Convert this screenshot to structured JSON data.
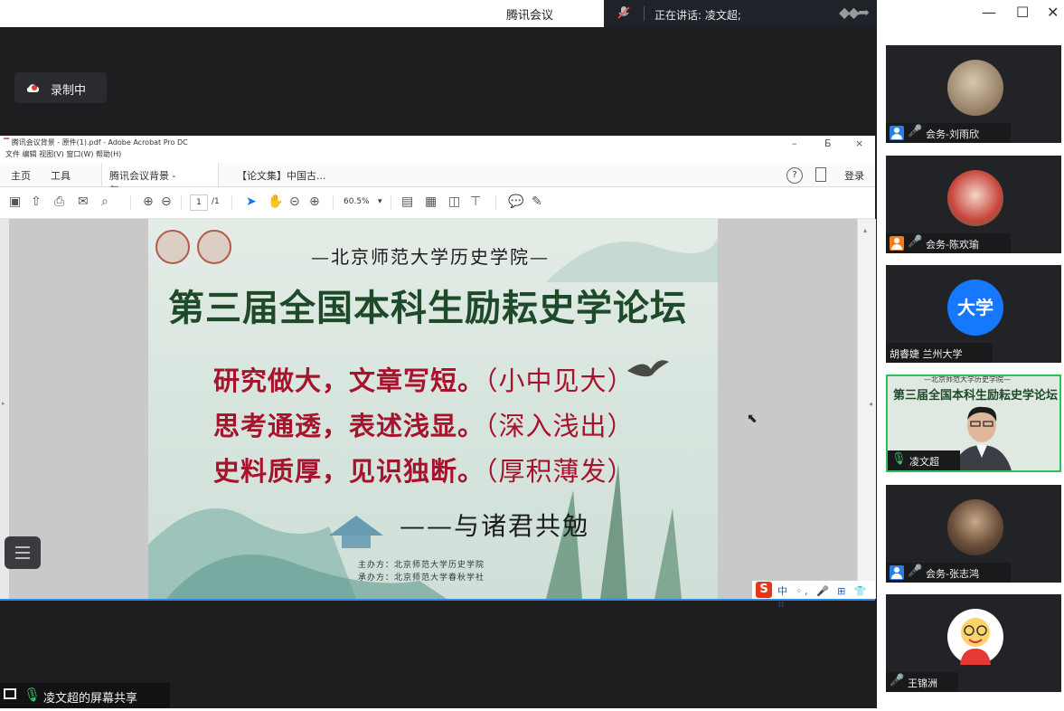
{
  "window": {
    "title": "腾讯会议",
    "speaking_label": "正在讲话: 凌文超;",
    "controls": {
      "minimize": "—",
      "maximize": "☐",
      "close": "✕"
    }
  },
  "stage": {
    "recording_label": "录制中",
    "share_label": "凌文超的屏幕共享"
  },
  "acrobat": {
    "title": "腾讯会议背景 - 原件(1).pdf - Adobe Acrobat Pro DC",
    "menu": "文件 编辑 视图(V) 窗口(W) 帮助(H)",
    "win_min": "–",
    "win_max": "Б",
    "win_close": "×",
    "nav_home": "主页",
    "nav_tools": "工具",
    "tab_active": "腾讯会议背景 - 复...",
    "tab_active_close": "×",
    "tab_other": "【论文集】中国古...",
    "help_icon": "?",
    "login": "登录",
    "page_current": "1",
    "page_total": "/1",
    "zoom": "60.5%"
  },
  "slide": {
    "subtitle": "—北京师范大学历史学院—",
    "title": "第三届全国本科生励耘史学论坛",
    "lines": [
      {
        "text": "研究做大，文章写短。",
        "note": "（小中见大）"
      },
      {
        "text": "思考通透，表述浅显。",
        "note": "（深入浅出）"
      },
      {
        "text": "史料质厚，见识独断。",
        "note": "（厚积薄发）"
      }
    ],
    "motto": "——与诸君共勉",
    "host": "主办方：北京师范大学历史学院",
    "co_host": "承办方：北京师范大学春秋学社"
  },
  "ime": {
    "logo": "S",
    "items": "中 ◦, 🎤 ⊞ 👕 ⠿"
  },
  "participants": [
    {
      "name": "会务-刘雨欣",
      "role_icon": "user-icon",
      "muted": true
    },
    {
      "name": "会务-陈欢瑜",
      "role_icon": "user-icon",
      "muted": true
    },
    {
      "name": "胡睿婕 兰州大学",
      "avatar_text": "大学",
      "muted": false
    },
    {
      "name": "凌文超",
      "speaking": true,
      "slide_title": "第三届全国本科生励耘史学论坛",
      "slide_sub": "—北京师范大学历史学院—"
    },
    {
      "name": "会务-张志鸿",
      "role_icon": "user-icon",
      "muted": true
    },
    {
      "name": "王锦洲",
      "muted": true
    }
  ],
  "colors": {
    "stage_bg": "#1e1e20",
    "speaking_bg": "#1f2329",
    "slide_title": "#1e4a2a",
    "slide_red": "#a8132c",
    "accent_blue": "#2f8ae0",
    "speaking_border": "#2fbf5a"
  }
}
